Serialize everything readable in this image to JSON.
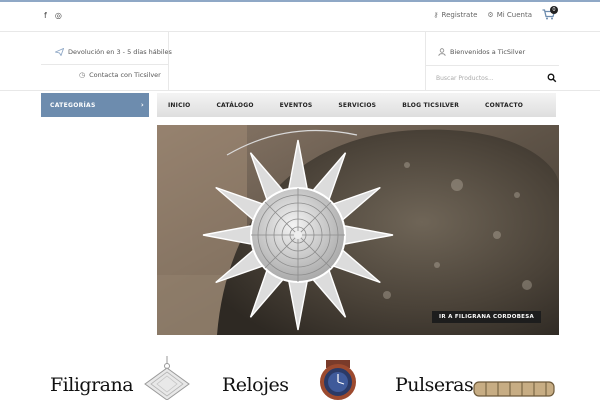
{
  "topbar": {
    "social": [
      {
        "icon": "facebook-icon",
        "glyph": "f"
      },
      {
        "icon": "instagram-icon",
        "glyph": "◎"
      }
    ],
    "register_label": "Registrate",
    "account_label": "Mi Cuenta",
    "cart_count": "0"
  },
  "info": {
    "returns_text": "Devolución en 3 - 5 días hábiles",
    "contact_text": "Contacta con Ticsilver",
    "welcome_text": "Bienvenidos a TicSilver"
  },
  "search": {
    "placeholder": "Buscar Productos..."
  },
  "nav": {
    "categories_label": "CATEGORÍAS",
    "items": [
      "INICIO",
      "CATÁLOGO",
      "EVENTOS",
      "SERVICIOS",
      "BLOG TICSILVER",
      "CONTACTO"
    ]
  },
  "hero": {
    "button_label": "IR A FILIGRANA CORDOBESA"
  },
  "categories": {
    "items": [
      "Filigrana",
      "Relojes",
      "Pulseras"
    ]
  },
  "colors": {
    "accent": "#6d8cae",
    "topline": "#8fa8c6",
    "dark": "#1d1d1d"
  }
}
